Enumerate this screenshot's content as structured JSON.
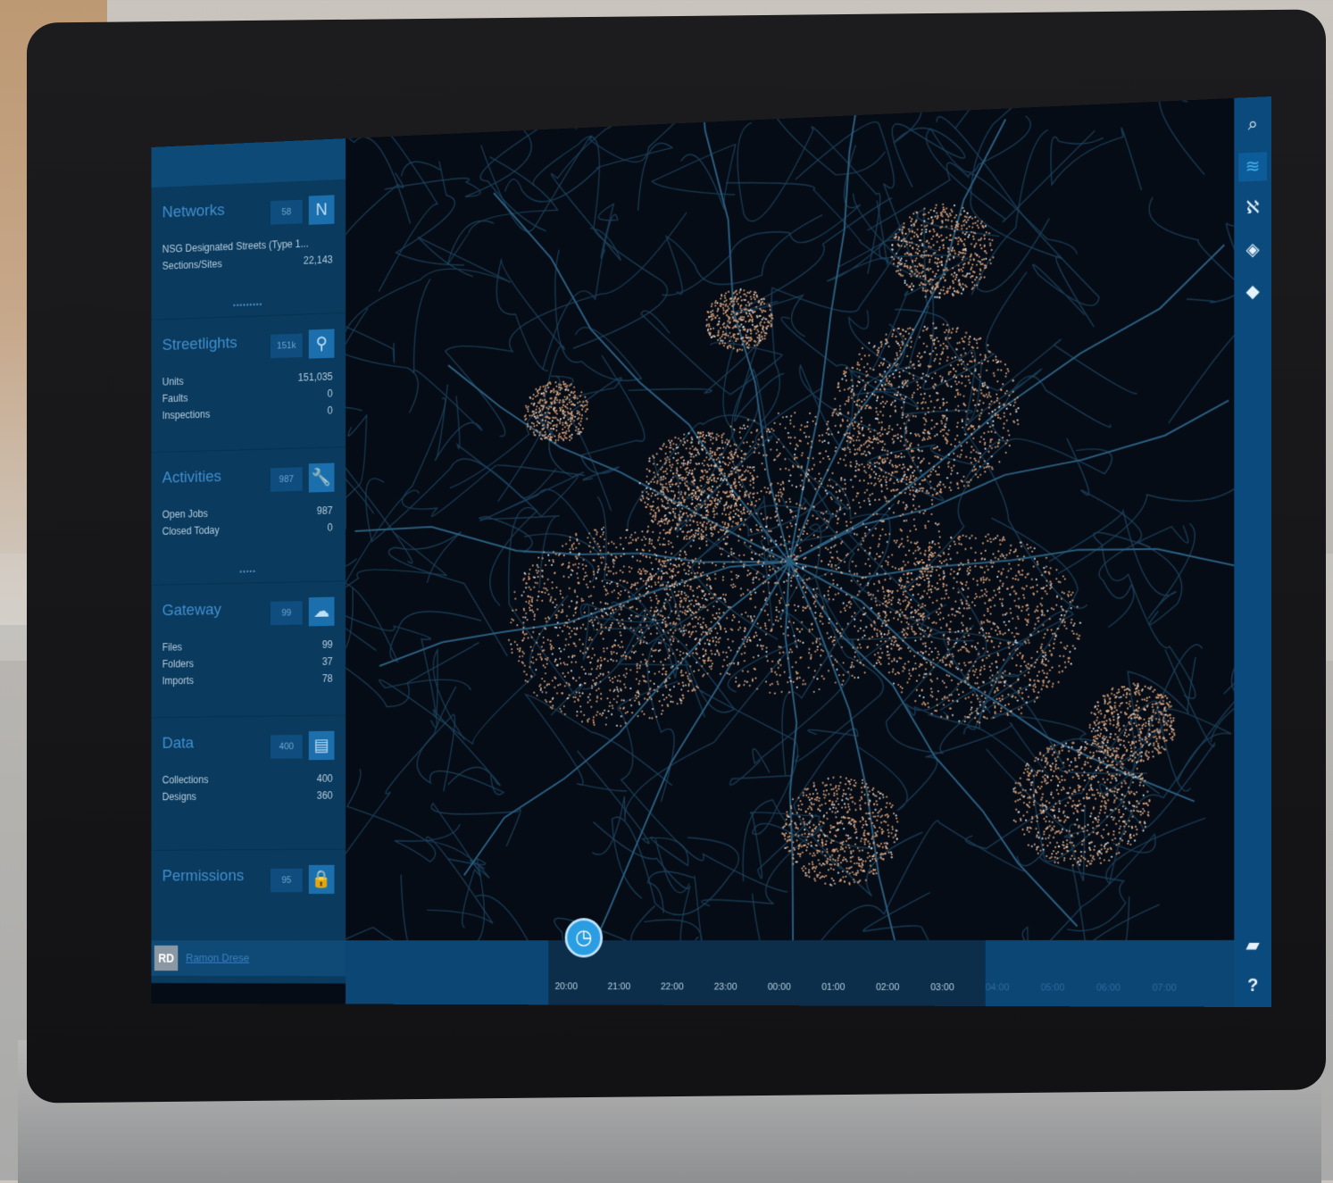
{
  "sidebar": {
    "cards": [
      {
        "title": "Networks",
        "count": "58",
        "icon": "network-icon",
        "icon_glyph": "N",
        "rows": [
          {
            "label": "NSG Designated Streets (Type 1...",
            "value": ""
          },
          {
            "label": "Sections/Sites",
            "value": "22,143"
          }
        ],
        "dots": "•••••••••"
      },
      {
        "title": "Streetlights",
        "count": "151k",
        "icon": "streetlight-icon",
        "icon_glyph": "⚲",
        "rows": [
          {
            "label": "Units",
            "value": "151,035"
          },
          {
            "label": "Faults",
            "value": "0"
          },
          {
            "label": "Inspections",
            "value": "0"
          }
        ],
        "dots": ""
      },
      {
        "title": "Activities",
        "count": "987",
        "icon": "wrench-icon",
        "icon_glyph": "🔧",
        "rows": [
          {
            "label": "Open Jobs",
            "value": "987"
          },
          {
            "label": "Closed Today",
            "value": "0"
          }
        ],
        "dots": "•••••"
      },
      {
        "title": "Gateway",
        "count": "99",
        "icon": "cloud-icon",
        "icon_glyph": "☁",
        "rows": [
          {
            "label": "Files",
            "value": "99"
          },
          {
            "label": "Folders",
            "value": "37"
          },
          {
            "label": "Imports",
            "value": "78"
          }
        ],
        "dots": ""
      },
      {
        "title": "Data",
        "count": "400",
        "icon": "database-icon",
        "icon_glyph": "▤",
        "rows": [
          {
            "label": "Collections",
            "value": "400"
          },
          {
            "label": "Designs",
            "value": "360"
          }
        ],
        "dots": ""
      },
      {
        "title": "Permissions",
        "count": "95",
        "icon": "lock-icon",
        "icon_glyph": "🔒",
        "rows": [],
        "dots": ""
      }
    ],
    "user": {
      "initials": "RD",
      "name": "Ramon Drese"
    }
  },
  "timeline": {
    "labels": [
      "20:00",
      "21:00",
      "22:00",
      "23:00",
      "00:00",
      "01:00",
      "02:00",
      "03:00",
      "04:00",
      "05:00",
      "06:00",
      "07:00"
    ],
    "clock_icon": "clock-icon"
  },
  "rail": {
    "buttons": [
      "search-icon",
      "layers-active-icon",
      "network-icon",
      "layers-icon",
      "tag-icon",
      "folder-icon",
      "help-icon"
    ]
  },
  "colors": {
    "map_bg": "#050c16",
    "road": "#1e4560",
    "lights": "#e2a77e",
    "highlight": "#dfeefc",
    "sidebar": "#0a3a5d",
    "accent": "#2a9de3"
  }
}
